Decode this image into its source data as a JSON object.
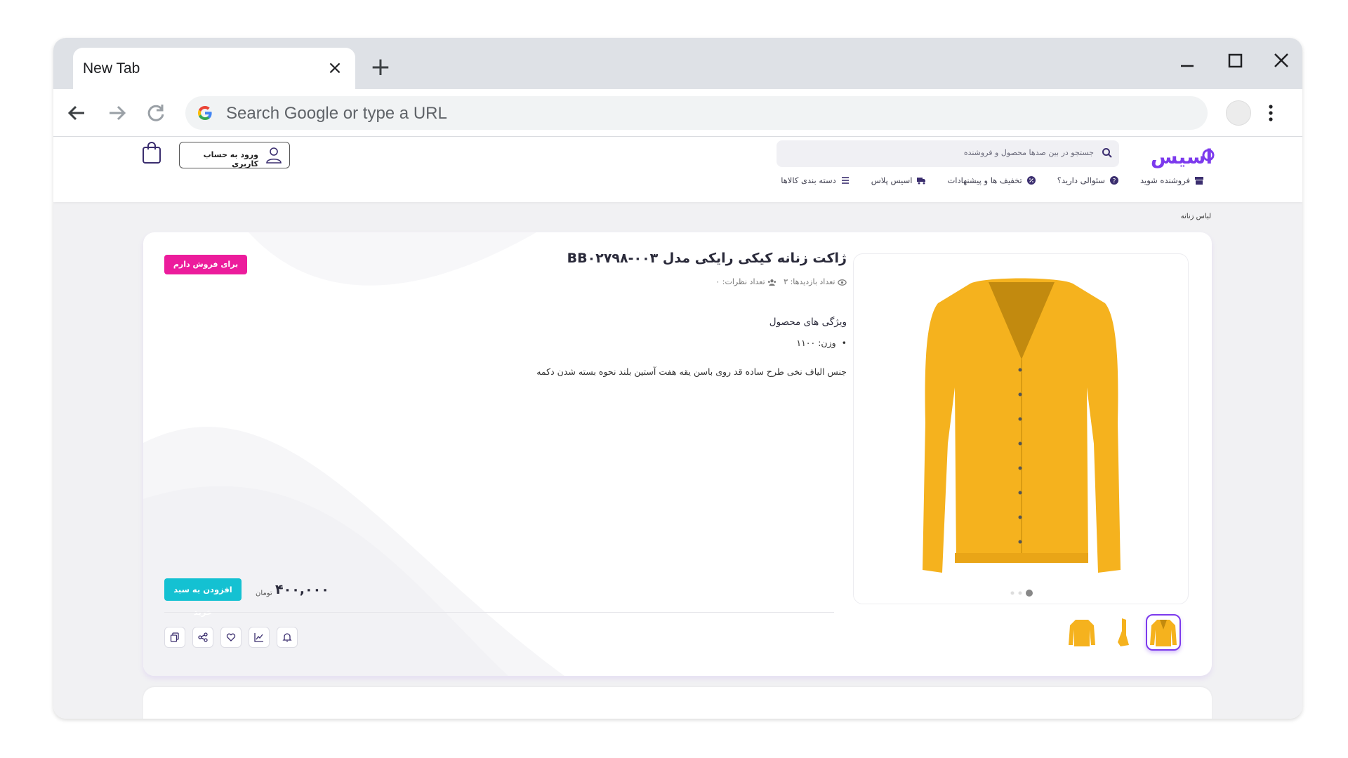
{
  "browser": {
    "tab_title": "New Tab",
    "tab_close": "×",
    "new_tab": "+",
    "omnibox_placeholder": "Search Google or type a URL"
  },
  "site": {
    "logo_text": "اسیس",
    "search_placeholder": "جستجو در بین صدها محصول و فروشنده",
    "login_label": "ورود به حساب کاربری",
    "nav": [
      {
        "label": "دسته بندی کالاها",
        "icon": "menu-icon"
      },
      {
        "label": "اسیس پلاس",
        "icon": "truck-icon"
      },
      {
        "label": "تخفیف ها و پیشنهادات",
        "icon": "discount-icon"
      },
      {
        "label": "سئوالی دارید؟",
        "icon": "question-icon"
      },
      {
        "label": "فروشنده شوید",
        "icon": "store-icon"
      }
    ],
    "breadcrumb": "لباس زنانه"
  },
  "product": {
    "title": "ژاکت زنانه کیکی رایکی مدل BB۰۲۷۹۸-۰۰۳",
    "views_label": "تعداد بازدیدها: ۳",
    "comments_label": "تعداد نظرات: ۰",
    "features_heading": "ویژگی های محصول",
    "feature_weight": "وزن: ۱۱۰۰",
    "description": "جنس الیاف نخی طرح ساده قد روی باسن یقه هفت آستین بلند نحوه بسته شدن دکمه",
    "sell_button": "برای فروش دارم",
    "add_to_cart": "افزودن به سبد خرید",
    "price": "۴۰۰,۰۰۰",
    "currency": "تومان",
    "image_color": "#f5b21e",
    "thumbnails": [
      {
        "name": "thumbnail-1",
        "active": true
      },
      {
        "name": "thumbnail-2",
        "active": false
      },
      {
        "name": "thumbnail-3",
        "active": false
      }
    ],
    "actions": [
      "bell-icon",
      "chart-icon",
      "heart-icon",
      "share-icon",
      "copy-icon"
    ]
  },
  "colors": {
    "brand": "#7c3aed",
    "sell_button": "#ec1c9c",
    "cart_button": "#14c1d2"
  }
}
